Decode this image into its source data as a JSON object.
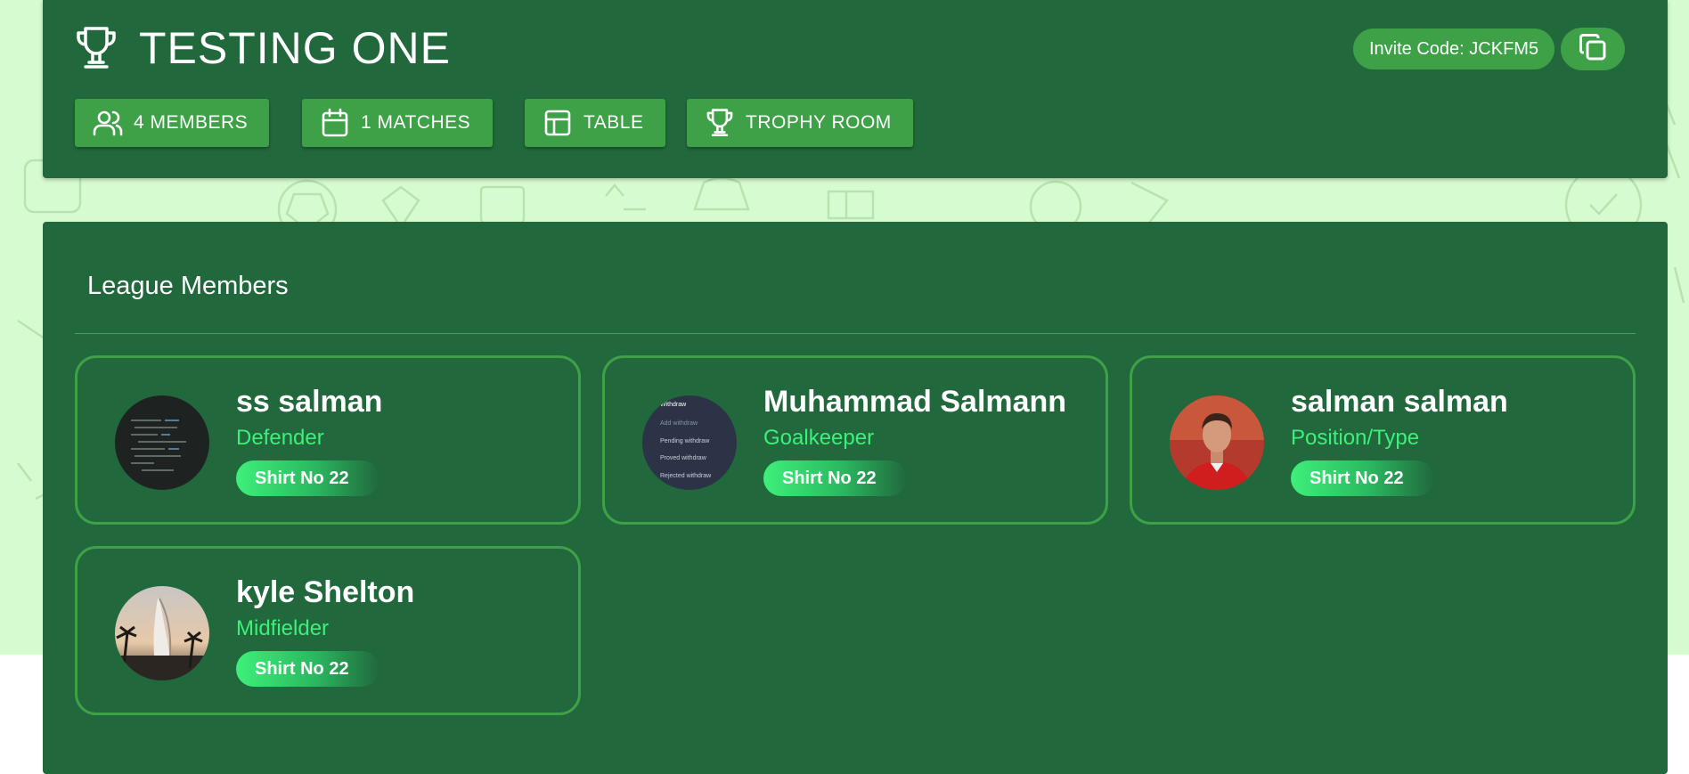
{
  "league": {
    "title": "TESTING ONE",
    "invite_code_label": "Invite Code: JCKFM5"
  },
  "nav": {
    "members_label": "4 MEMBERS",
    "matches_label": "1 MATCHES",
    "table_label": "TABLE",
    "trophy_label": "TROPHY ROOM"
  },
  "members_section": {
    "title": "League Members",
    "members": [
      {
        "name": "ss salman",
        "position": "Defender",
        "shirt": "Shirt No 22",
        "avatar": "code-screenshot-avatar"
      },
      {
        "name": "Muhammad Salmann",
        "position": "Goalkeeper",
        "shirt": "Shirt No 22",
        "avatar": "withdraw-menu-avatar"
      },
      {
        "name": "salman salman",
        "position": "Position/Type",
        "shirt": "Shirt No 22",
        "avatar": "red-jersey-player-avatar"
      },
      {
        "name": "kyle Shelton",
        "position": "Midfielder",
        "shirt": "Shirt No 22",
        "avatar": "burj-al-arab-avatar"
      }
    ],
    "avatar2_menu": {
      "heading": "Withdraw",
      "items": [
        "Add withdraw",
        "Pending withdraw",
        "Proved withdraw",
        "Rejected withdraw"
      ]
    }
  },
  "colors": {
    "header_bg": "#21683c",
    "button_bg": "#3ea148",
    "accent_green": "#3cf07a",
    "page_bg": "#d7fbd0"
  },
  "icons": {
    "title": "trophy-icon",
    "copy": "copy-icon",
    "members": "users-icon",
    "matches": "calendar-icon",
    "table": "table-icon",
    "trophy_room": "trophy-icon"
  }
}
